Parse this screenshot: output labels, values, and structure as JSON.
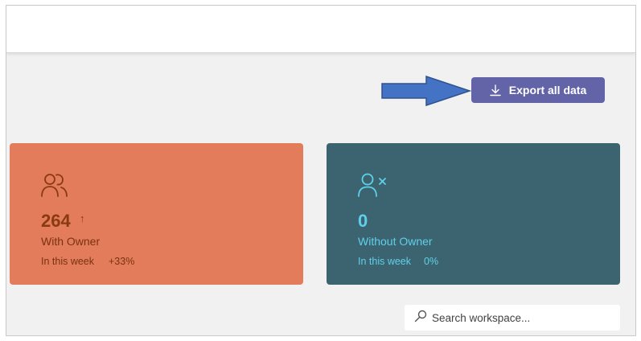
{
  "toolbar": {
    "export_label": "Export all data",
    "export_icon": "download-icon",
    "accent_color": "#6264a7"
  },
  "annotation": {
    "arrow_color": "#4472c4"
  },
  "cards": {
    "with_owner": {
      "icon": "people-icon",
      "value": "264",
      "trend_symbol": "↑",
      "label": "With Owner",
      "period": "In this week",
      "delta": "+33%",
      "color": "#e27c5a"
    },
    "without_owner": {
      "icon": "person-remove-icon",
      "value": "0",
      "label": "Without Owner",
      "period": "In this week",
      "delta": "0%",
      "color": "#3c6470"
    }
  },
  "search": {
    "placeholder": "Search workspace...",
    "icon": "search-icon"
  }
}
